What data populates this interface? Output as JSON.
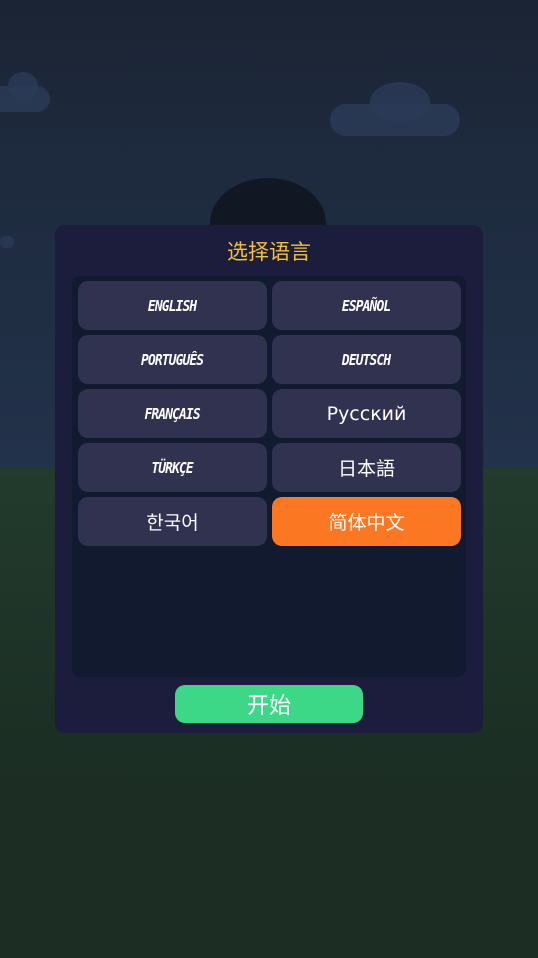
{
  "dialog": {
    "title": "选择语言",
    "start_label": "开始",
    "languages": [
      {
        "label": "ENGLISH"
      },
      {
        "label": "ESPAÑOL"
      },
      {
        "label": "PORTUGUÊS"
      },
      {
        "label": "DEUTSCH"
      },
      {
        "label": "FRANÇAIS"
      },
      {
        "label": "Русский"
      },
      {
        "label": "TÜRKÇE"
      },
      {
        "label": "日本語"
      },
      {
        "label": "한국어"
      },
      {
        "label": "简体中文"
      }
    ],
    "selected_language": "简体中文"
  },
  "colors": {
    "title": "#f3c233",
    "selected": "#fc7722",
    "button": "#313150",
    "start": "#3dd887",
    "dialog": "#1c1c3c",
    "panel": "#111a2e"
  }
}
